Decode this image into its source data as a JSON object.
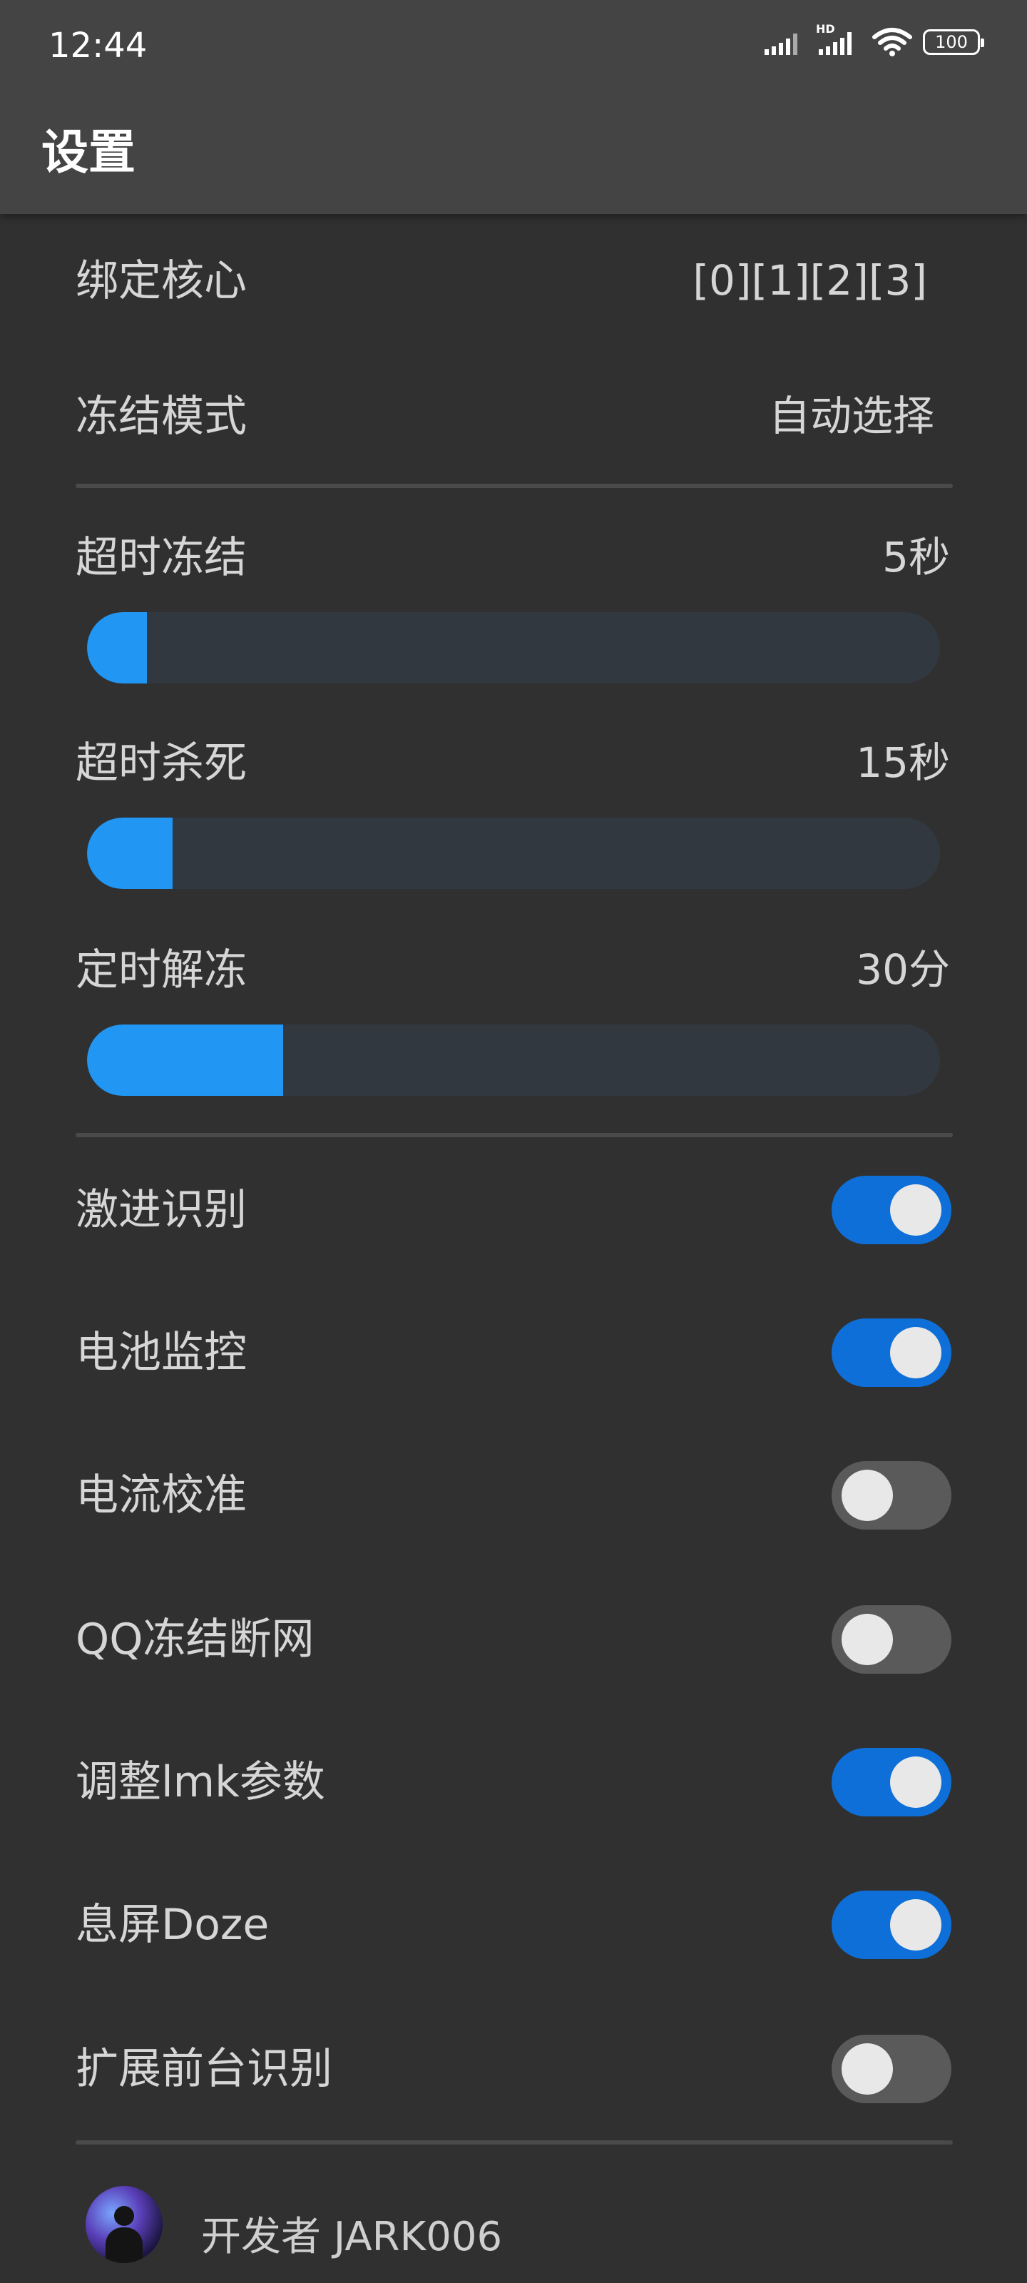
{
  "status_bar": {
    "time": "12:44",
    "hd_label": "HD",
    "battery": "100"
  },
  "header": {
    "title": "设置"
  },
  "settings": {
    "bind_core": {
      "label": "绑定核心",
      "value": "[0][1][2][3]"
    },
    "freeze_mode": {
      "label": "冻结模式",
      "value": "自动选择"
    }
  },
  "sliders": [
    {
      "label": "超时冻结",
      "value": "5秒",
      "fill_percent": 7
    },
    {
      "label": "超时杀死",
      "value": "15秒",
      "fill_percent": 10
    },
    {
      "label": "定时解冻",
      "value": "30分",
      "fill_percent": 23
    }
  ],
  "toggles": [
    {
      "label": "激进识别",
      "on": true
    },
    {
      "label": "电池监控",
      "on": true
    },
    {
      "label": "电流校准",
      "on": false
    },
    {
      "label": "QQ冻结断网",
      "on": false
    },
    {
      "label": "调整lmk参数",
      "on": true
    },
    {
      "label": "息屏Doze",
      "on": true
    },
    {
      "label": "扩展前台识别",
      "on": false
    }
  ],
  "footer": {
    "developer": "开发者 JARK006"
  },
  "colors": {
    "background": "#303030",
    "appbar": "#444444",
    "accent": "#2196f3",
    "toggle_on": "#0f6fd8",
    "toggle_off": "#5a5a5a"
  }
}
